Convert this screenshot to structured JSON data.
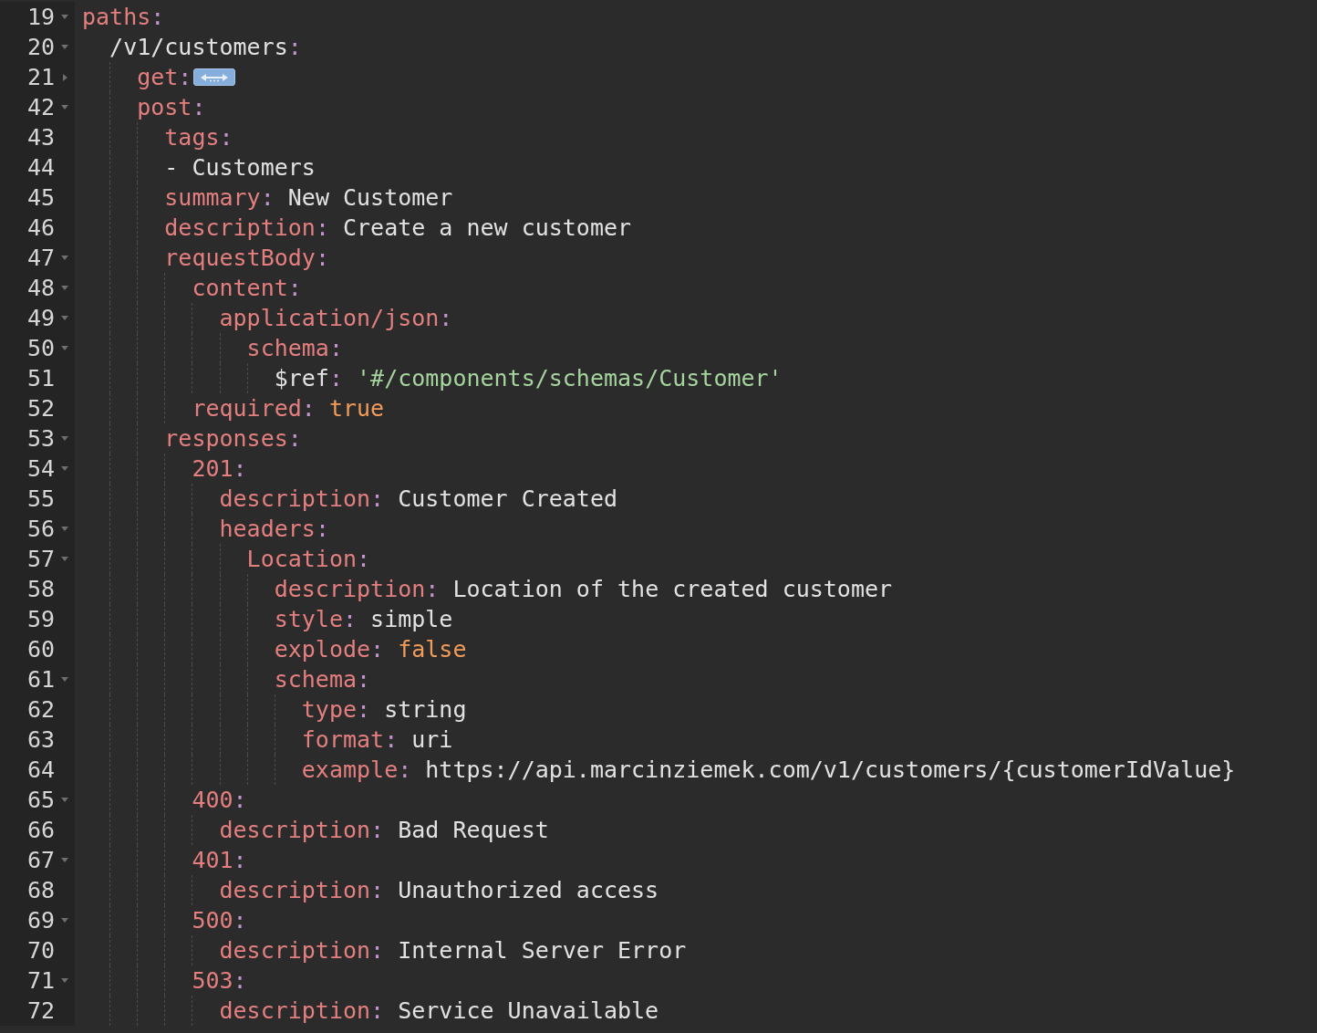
{
  "lines": [
    {
      "number": "19",
      "expanded": true,
      "tokens": [
        {
          "kind": "key",
          "text": "paths"
        },
        {
          "kind": "punct",
          "text": ":"
        }
      ]
    },
    {
      "number": "20",
      "expanded": true,
      "tokens": [
        {
          "kind": "value",
          "text": "  /v1/customers"
        },
        {
          "kind": "punct",
          "text": ":"
        }
      ]
    },
    {
      "number": "21",
      "expanded": false,
      "tokens": [
        {
          "kind": "key",
          "text": "    get"
        },
        {
          "kind": "punct",
          "text": ":"
        }
      ]
    },
    {
      "number": "42",
      "expanded": true,
      "tokens": [
        {
          "kind": "key",
          "text": "    post"
        },
        {
          "kind": "punct",
          "text": ":"
        }
      ]
    },
    {
      "number": "43",
      "tokens": [
        {
          "kind": "key",
          "text": "      tags"
        },
        {
          "kind": "punct",
          "text": ":"
        }
      ]
    },
    {
      "number": "44",
      "tokens": [
        {
          "kind": "value",
          "text": "      - Customers"
        }
      ]
    },
    {
      "number": "45",
      "tokens": [
        {
          "kind": "key",
          "text": "      summary"
        },
        {
          "kind": "punct",
          "text": ":"
        },
        {
          "kind": "value",
          "text": " New Customer"
        }
      ]
    },
    {
      "number": "46",
      "tokens": [
        {
          "kind": "key",
          "text": "      description"
        },
        {
          "kind": "punct",
          "text": ":"
        },
        {
          "kind": "value",
          "text": " Create a new customer"
        }
      ]
    },
    {
      "number": "47",
      "expanded": true,
      "tokens": [
        {
          "kind": "key",
          "text": "      requestBody"
        },
        {
          "kind": "punct",
          "text": ":"
        }
      ]
    },
    {
      "number": "48",
      "expanded": true,
      "tokens": [
        {
          "kind": "key",
          "text": "        content"
        },
        {
          "kind": "punct",
          "text": ":"
        }
      ]
    },
    {
      "number": "49",
      "expanded": true,
      "tokens": [
        {
          "kind": "key",
          "text": "          application/json"
        },
        {
          "kind": "punct",
          "text": ":"
        }
      ]
    },
    {
      "number": "50",
      "expanded": true,
      "tokens": [
        {
          "kind": "key",
          "text": "            schema"
        },
        {
          "kind": "punct",
          "text": ":"
        }
      ]
    },
    {
      "number": "51",
      "tokens": [
        {
          "kind": "value",
          "text": "              $ref"
        },
        {
          "kind": "punct",
          "text": ":"
        },
        {
          "kind": "string",
          "text": " '#/components/schemas/Customer'"
        }
      ]
    },
    {
      "number": "52",
      "tokens": [
        {
          "kind": "key",
          "text": "        required"
        },
        {
          "kind": "punct",
          "text": ":"
        },
        {
          "kind": "bool",
          "text": " true"
        }
      ]
    },
    {
      "number": "53",
      "expanded": true,
      "tokens": [
        {
          "kind": "key",
          "text": "      responses"
        },
        {
          "kind": "punct",
          "text": ":"
        }
      ]
    },
    {
      "number": "54",
      "expanded": true,
      "tokens": [
        {
          "kind": "key",
          "text": "        201"
        },
        {
          "kind": "punct",
          "text": ":"
        }
      ]
    },
    {
      "number": "55",
      "tokens": [
        {
          "kind": "key",
          "text": "          description"
        },
        {
          "kind": "punct",
          "text": ":"
        },
        {
          "kind": "value",
          "text": " Customer Created"
        }
      ]
    },
    {
      "number": "56",
      "expanded": true,
      "tokens": [
        {
          "kind": "key",
          "text": "          headers"
        },
        {
          "kind": "punct",
          "text": ":"
        }
      ]
    },
    {
      "number": "57",
      "expanded": true,
      "tokens": [
        {
          "kind": "key",
          "text": "            Location"
        },
        {
          "kind": "punct",
          "text": ":"
        }
      ]
    },
    {
      "number": "58",
      "tokens": [
        {
          "kind": "key",
          "text": "              description"
        },
        {
          "kind": "punct",
          "text": ":"
        },
        {
          "kind": "value",
          "text": " Location of the created customer"
        }
      ]
    },
    {
      "number": "59",
      "tokens": [
        {
          "kind": "key",
          "text": "              style"
        },
        {
          "kind": "punct",
          "text": ":"
        },
        {
          "kind": "value",
          "text": " simple"
        }
      ]
    },
    {
      "number": "60",
      "tokens": [
        {
          "kind": "key",
          "text": "              explode"
        },
        {
          "kind": "punct",
          "text": ":"
        },
        {
          "kind": "bool",
          "text": " false"
        }
      ]
    },
    {
      "number": "61",
      "expanded": true,
      "tokens": [
        {
          "kind": "key",
          "text": "              schema"
        },
        {
          "kind": "punct",
          "text": ":"
        }
      ]
    },
    {
      "number": "62",
      "tokens": [
        {
          "kind": "key",
          "text": "                type"
        },
        {
          "kind": "punct",
          "text": ":"
        },
        {
          "kind": "value",
          "text": " string"
        }
      ]
    },
    {
      "number": "63",
      "tokens": [
        {
          "kind": "key",
          "text": "                format"
        },
        {
          "kind": "punct",
          "text": ":"
        },
        {
          "kind": "value",
          "text": " uri"
        }
      ]
    },
    {
      "number": "64",
      "tokens": [
        {
          "kind": "key",
          "text": "                example"
        },
        {
          "kind": "punct",
          "text": ":"
        },
        {
          "kind": "value",
          "text": " https://api.marcinziemek.com/v1/customers/{customerIdValue}"
        }
      ]
    },
    {
      "number": "65",
      "expanded": true,
      "tokens": [
        {
          "kind": "key",
          "text": "        400"
        },
        {
          "kind": "punct",
          "text": ":"
        }
      ]
    },
    {
      "number": "66",
      "tokens": [
        {
          "kind": "key",
          "text": "          description"
        },
        {
          "kind": "punct",
          "text": ":"
        },
        {
          "kind": "value",
          "text": " Bad Request"
        }
      ]
    },
    {
      "number": "67",
      "expanded": true,
      "tokens": [
        {
          "kind": "key",
          "text": "        401"
        },
        {
          "kind": "punct",
          "text": ":"
        }
      ]
    },
    {
      "number": "68",
      "tokens": [
        {
          "kind": "key",
          "text": "          description"
        },
        {
          "kind": "punct",
          "text": ":"
        },
        {
          "kind": "value",
          "text": " Unauthorized access"
        }
      ]
    },
    {
      "number": "69",
      "expanded": true,
      "tokens": [
        {
          "kind": "key",
          "text": "        500"
        },
        {
          "kind": "punct",
          "text": ":"
        }
      ]
    },
    {
      "number": "70",
      "tokens": [
        {
          "kind": "key",
          "text": "          description"
        },
        {
          "kind": "punct",
          "text": ":"
        },
        {
          "kind": "value",
          "text": " Internal Server Error"
        }
      ]
    },
    {
      "number": "71",
      "expanded": true,
      "tokens": [
        {
          "kind": "key",
          "text": "        503"
        },
        {
          "kind": "punct",
          "text": ":"
        }
      ]
    },
    {
      "number": "72",
      "tokens": [
        {
          "kind": "key",
          "text": "          description"
        },
        {
          "kind": "punct",
          "text": ":"
        },
        {
          "kind": "value",
          "text": " Service Unavailable"
        }
      ]
    }
  ]
}
